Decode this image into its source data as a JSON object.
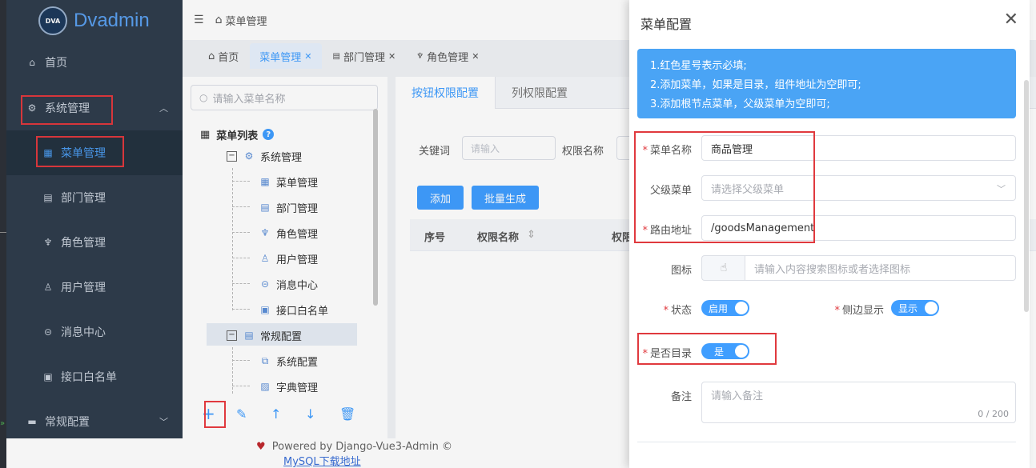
{
  "brand": {
    "logo_text": "Dvadmin",
    "badge": "DVA"
  },
  "sidebar": {
    "items": [
      {
        "label": "首页",
        "icon": "home-icon"
      },
      {
        "label": "系统管理",
        "icon": "gear-icon"
      },
      {
        "label": "菜单管理",
        "icon": "grid-icon"
      },
      {
        "label": "部门管理",
        "icon": "building-icon"
      },
      {
        "label": "角色管理",
        "icon": "role-icon"
      },
      {
        "label": "用户管理",
        "icon": "user-icon"
      },
      {
        "label": "消息中心",
        "icon": "message-icon"
      },
      {
        "label": "接口白名单",
        "icon": "whitelist-icon"
      },
      {
        "label": "常规配置",
        "icon": "config-icon"
      }
    ]
  },
  "header": {
    "breadcrumb": "菜单管理"
  },
  "tabs": [
    {
      "label": "首页"
    },
    {
      "label": "菜单管理"
    },
    {
      "label": "部门管理"
    },
    {
      "label": "角色管理"
    }
  ],
  "tree": {
    "search_placeholder": "请输入菜单名称",
    "title": "菜单列表",
    "nodes": [
      {
        "label": "系统管理"
      },
      {
        "label": "菜单管理"
      },
      {
        "label": "部门管理"
      },
      {
        "label": "角色管理"
      },
      {
        "label": "用户管理"
      },
      {
        "label": "消息中心"
      },
      {
        "label": "接口白名单"
      },
      {
        "label": "常规配置"
      },
      {
        "label": "系统配置"
      },
      {
        "label": "字典管理"
      }
    ]
  },
  "perm": {
    "tab_buttons": "按钮权限配置",
    "tab_columns": "列权限配置",
    "keyword_label": "关键词",
    "keyword_placeholder": "请输入",
    "perm_name_label": "权限名称",
    "add_button": "添加",
    "batch_button": "批量生成",
    "col_index": "序号",
    "col_name": "权限名称",
    "col_sort": "⇕",
    "col_third": "权限"
  },
  "footer": {
    "text": "Powered by Django-Vue3-Admin ©"
  },
  "underlying_link": "MySQL下载地址",
  "drawer": {
    "title": "菜单配置",
    "tips": [
      "1.红色星号表示必填;",
      "2.添加菜单，如果是目录，组件地址为空即可;",
      "3.添加根节点菜单，父级菜单为空即可;"
    ],
    "fields": {
      "menu_name_label": "菜单名称",
      "menu_name_value": "商品管理",
      "parent_label": "父级菜单",
      "parent_placeholder": "请选择父级菜单",
      "route_label": "路由地址",
      "route_value": "/goodsManagement",
      "icon_label": "图标",
      "icon_placeholder": "请输入内容搜索图标或者选择图标",
      "status_label": "状态",
      "status_value": "启用",
      "sidebar_label": "侧边显示",
      "sidebar_value": "显示",
      "is_dir_label": "是否目录",
      "is_dir_value": "是",
      "remark_label": "备注",
      "remark_placeholder": "请输入备注",
      "remark_counter": "0 / 200"
    }
  },
  "colors": {
    "primary": "#409eff",
    "sidebar_bg": "#2f3d4d",
    "highlight_red": "#e0393e",
    "tip_bg": "#4aa4f5"
  }
}
